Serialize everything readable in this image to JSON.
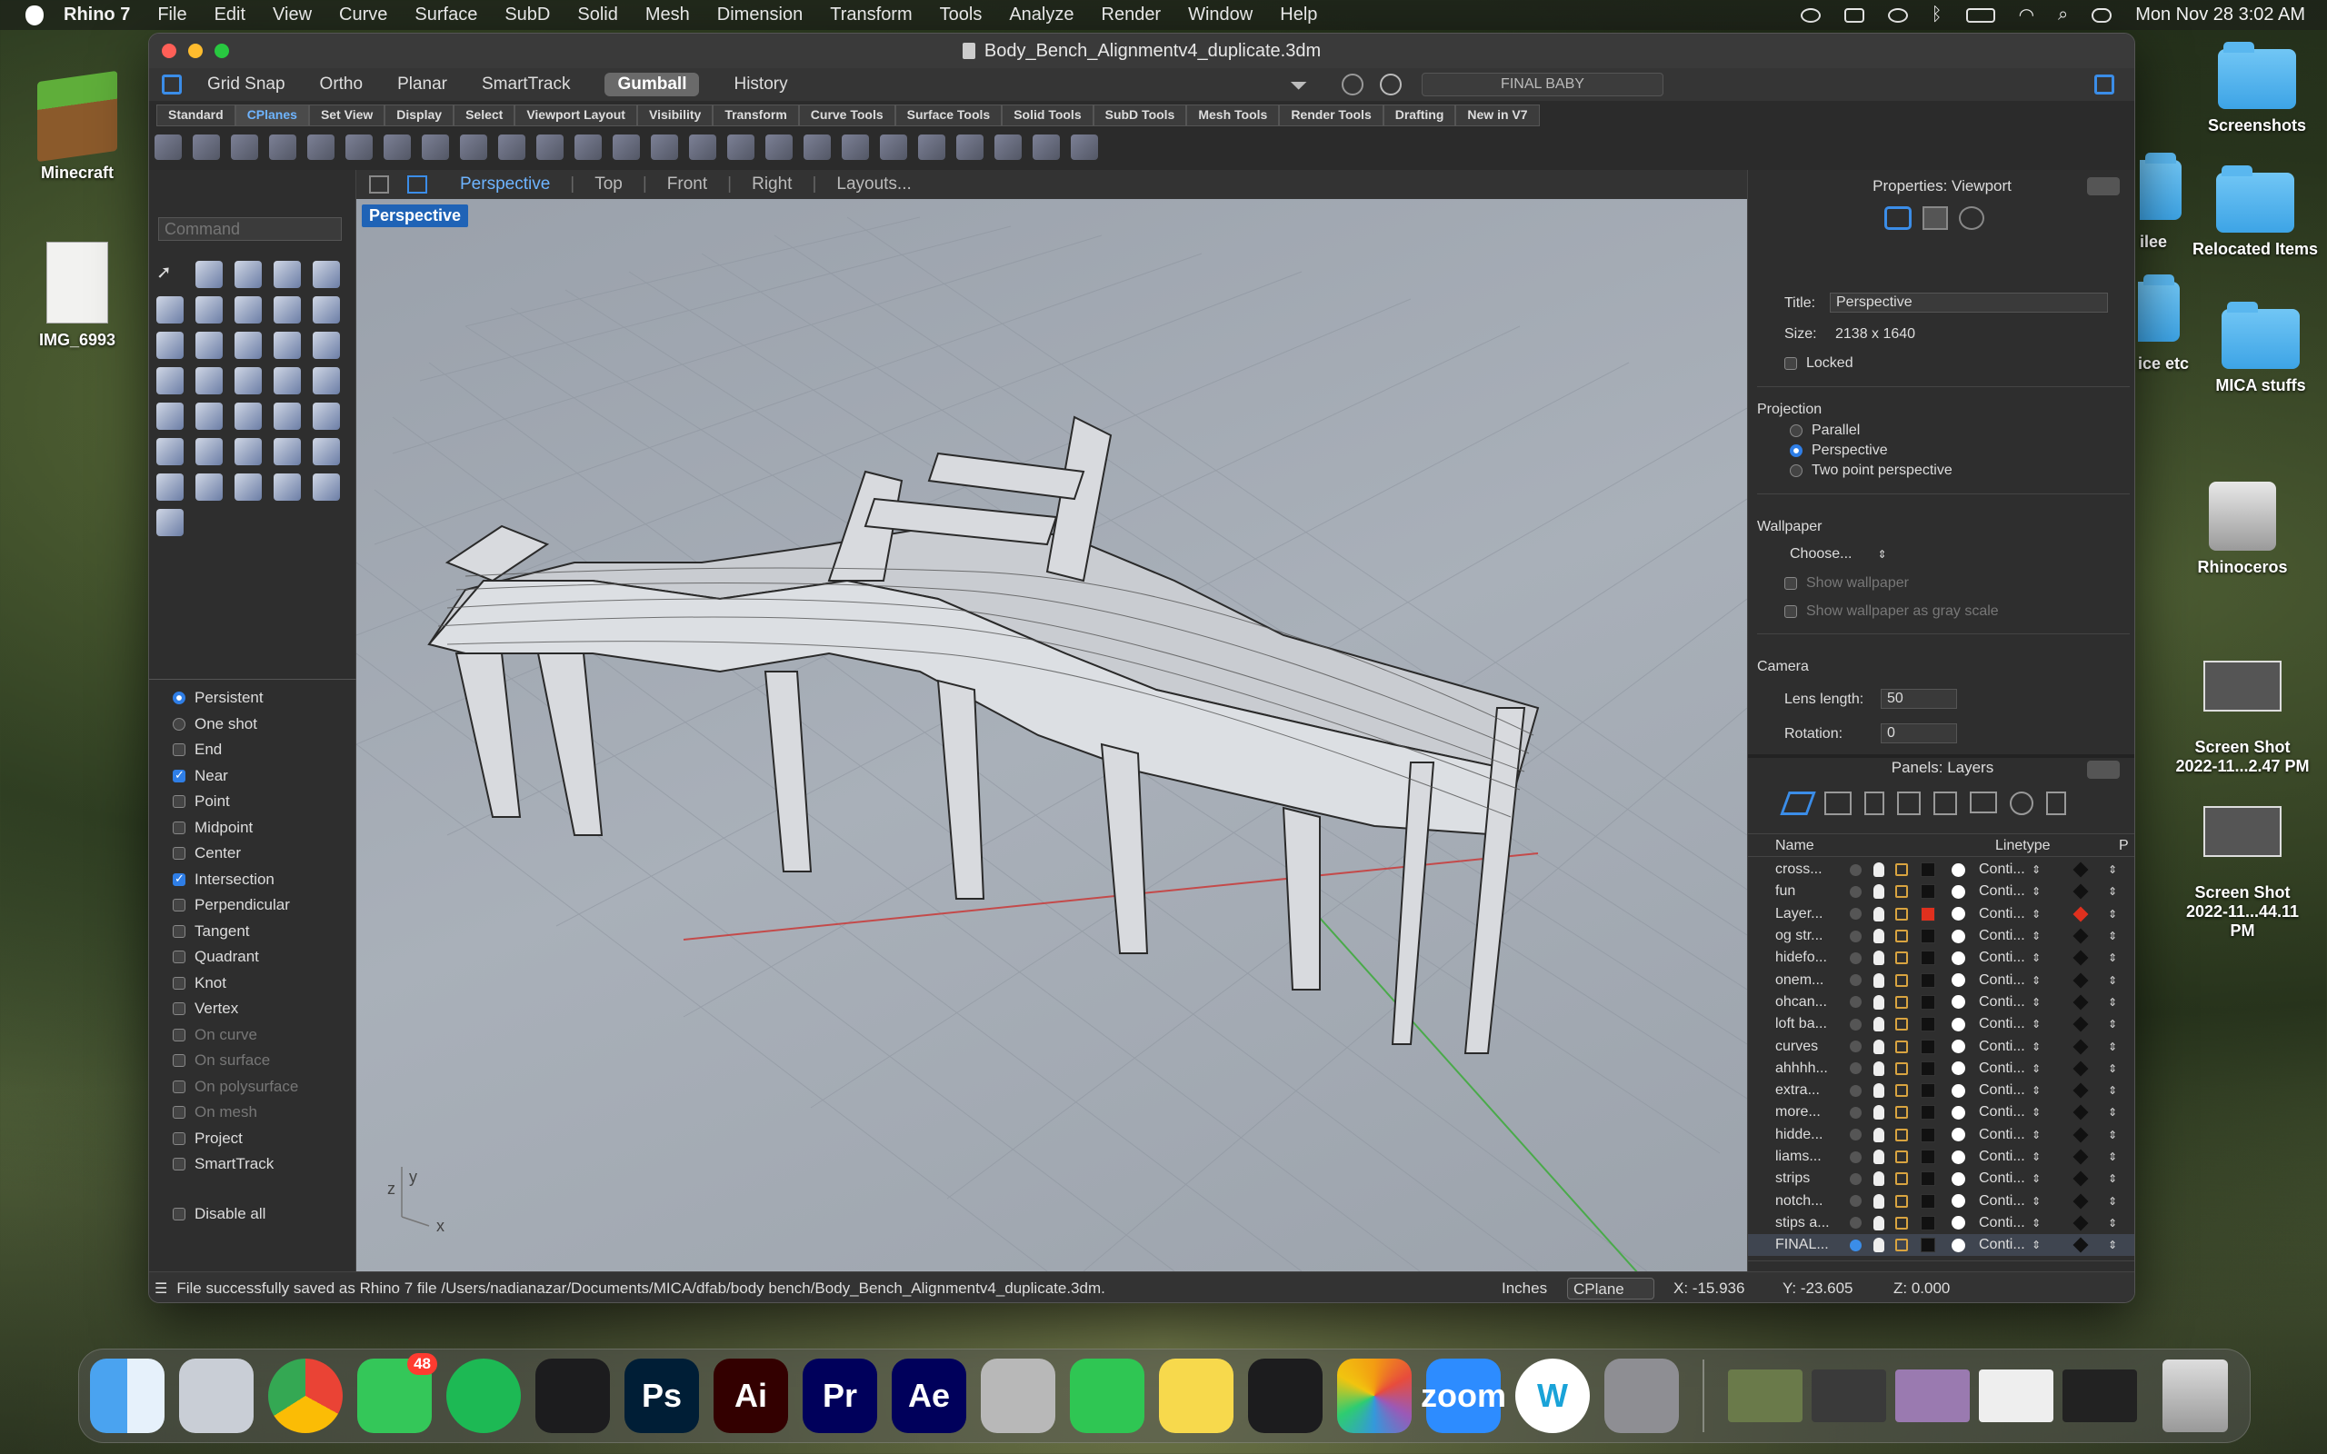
{
  "menubar": {
    "app": "Rhino 7",
    "items": [
      "File",
      "Edit",
      "View",
      "Curve",
      "Surface",
      "SubD",
      "Solid",
      "Mesh",
      "Dimension",
      "Transform",
      "Tools",
      "Analyze",
      "Render",
      "Window",
      "Help"
    ],
    "datetime": "Mon Nov 28  3:02 AM"
  },
  "desktop": {
    "left": [
      {
        "label": "Minecraft"
      },
      {
        "label": "IMG_6993"
      }
    ],
    "right": [
      {
        "label": "Screenshots"
      },
      {
        "label": "Relocated Items"
      },
      {
        "label": "MICA stuffs"
      },
      {
        "label": "Rhinoceros"
      },
      {
        "label": "Screen Shot\n2022-11...2.47 PM"
      },
      {
        "label": "Screen Shot\n2022-11...44.11 PM"
      }
    ],
    "partial": [
      "ilee",
      "ice etc"
    ]
  },
  "window": {
    "title": "Body_Bench_Alignmentv4_duplicate.3dm"
  },
  "toolbar": {
    "items": [
      "Grid Snap",
      "Ortho",
      "Planar",
      "SmartTrack",
      "Gumball",
      "History"
    ],
    "active": "Gumball",
    "layer_field": "FINAL BABY"
  },
  "tabs": [
    "Standard",
    "CPlanes",
    "Set View",
    "Display",
    "Select",
    "Viewport Layout",
    "Visibility",
    "Transform",
    "Curve Tools",
    "Surface Tools",
    "Solid Tools",
    "SubD Tools",
    "Mesh Tools",
    "Render Tools",
    "Drafting",
    "New in V7"
  ],
  "tab_active": "CPlanes",
  "command": {
    "placeholder": "Command"
  },
  "osnap": {
    "modes": [
      {
        "label": "Persistent",
        "type": "radio",
        "on": true
      },
      {
        "label": "One shot",
        "type": "radio",
        "on": false
      }
    ],
    "items": [
      {
        "label": "End",
        "on": false
      },
      {
        "label": "Near",
        "on": true
      },
      {
        "label": "Point",
        "on": false
      },
      {
        "label": "Midpoint",
        "on": false
      },
      {
        "label": "Center",
        "on": false
      },
      {
        "label": "Intersection",
        "on": true
      },
      {
        "label": "Perpendicular",
        "on": false
      },
      {
        "label": "Tangent",
        "on": false
      },
      {
        "label": "Quadrant",
        "on": false
      },
      {
        "label": "Knot",
        "on": false
      },
      {
        "label": "Vertex",
        "on": false
      },
      {
        "label": "On curve",
        "on": false,
        "dim": true
      },
      {
        "label": "On surface",
        "on": false,
        "dim": true
      },
      {
        "label": "On polysurface",
        "on": false,
        "dim": true
      },
      {
        "label": "On mesh",
        "on": false,
        "dim": true
      },
      {
        "label": "Project",
        "on": false
      },
      {
        "label": "SmartTrack",
        "on": false
      }
    ],
    "disable_all": "Disable all"
  },
  "viewport_tabs": [
    "Perspective",
    "Top",
    "Front",
    "Right",
    "Layouts..."
  ],
  "viewport": {
    "label": "Perspective",
    "axis_z": "z",
    "axis_y": "y",
    "axis_x": "x"
  },
  "properties": {
    "header": "Properties: Viewport",
    "title_label": "Title:",
    "title_value": "Perspective",
    "size_label": "Size:",
    "size_value": "2138 x 1640",
    "locked": "Locked",
    "projection_label": "Projection",
    "projections": [
      {
        "label": "Parallel",
        "on": false
      },
      {
        "label": "Perspective",
        "on": true
      },
      {
        "label": "Two point perspective",
        "on": false
      }
    ],
    "wallpaper_label": "Wallpaper",
    "wallpaper_choose": "Choose...",
    "show_wallpaper": "Show wallpaper",
    "gray_scale": "Show wallpaper as gray scale",
    "camera_label": "Camera",
    "lens_label": "Lens length:",
    "lens_value": "50",
    "rotation_label": "Rotation:",
    "rotation_value": "0"
  },
  "layers": {
    "header": "Panels: Layers",
    "col_name": "Name",
    "col_linetype": "Linetype",
    "col_p": "P",
    "rows": [
      {
        "name": "cross...",
        "color": "#111111",
        "lt": "Conti..."
      },
      {
        "name": "fun",
        "color": "#111111",
        "lt": "Conti..."
      },
      {
        "name": "Layer...",
        "color": "#e0301e",
        "lt": "Conti...",
        "red": true
      },
      {
        "name": "og str...",
        "color": "#111111",
        "lt": "Conti..."
      },
      {
        "name": "hidefo...",
        "color": "#111111",
        "lt": "Conti..."
      },
      {
        "name": "onem...",
        "color": "#111111",
        "lt": "Conti..."
      },
      {
        "name": "ohcan...",
        "color": "#111111",
        "lt": "Conti..."
      },
      {
        "name": "loft ba...",
        "color": "#111111",
        "lt": "Conti..."
      },
      {
        "name": "curves",
        "color": "#111111",
        "lt": "Conti..."
      },
      {
        "name": "ahhhh...",
        "color": "#111111",
        "lt": "Conti..."
      },
      {
        "name": "extra...",
        "color": "#111111",
        "lt": "Conti..."
      },
      {
        "name": "more...",
        "color": "#111111",
        "lt": "Conti..."
      },
      {
        "name": "hidde...",
        "color": "#111111",
        "lt": "Conti..."
      },
      {
        "name": "liams...",
        "color": "#111111",
        "lt": "Conti..."
      },
      {
        "name": "strips",
        "color": "#111111",
        "lt": "Conti..."
      },
      {
        "name": "notch...",
        "color": "#111111",
        "lt": "Conti..."
      },
      {
        "name": "stips a...",
        "color": "#111111",
        "lt": "Conti..."
      },
      {
        "name": "FINAL...",
        "color": "#111111",
        "lt": "Conti...",
        "current": true
      }
    ]
  },
  "status": {
    "message": "File successfully saved as Rhino 7 file /Users/nadianazar/Documents/MICA/dfab/body bench/Body_Bench_Alignmentv4_duplicate.3dm.",
    "units": "Inches",
    "cplane": "CPlane",
    "x": "X: -15.936",
    "y": "Y: -23.605",
    "z": "Z: 0.000"
  },
  "dock": {
    "messages_badge": "48",
    "apps": [
      {
        "name": "finder",
        "label": "",
        "bg": "#4aa3f0"
      },
      {
        "name": "launchpad",
        "label": "",
        "bg": "#c9ced6"
      },
      {
        "name": "chrome",
        "label": "",
        "bg": "#e8e8e8"
      },
      {
        "name": "messages",
        "label": "",
        "bg": "#34c759"
      },
      {
        "name": "spotify",
        "label": "",
        "bg": "#1db954"
      },
      {
        "name": "voice",
        "label": "",
        "bg": "#1c1c1e"
      },
      {
        "name": "photoshop",
        "label": "Ps",
        "bg": "#001e36"
      },
      {
        "name": "illustrator",
        "label": "Ai",
        "bg": "#330000"
      },
      {
        "name": "premiere",
        "label": "Pr",
        "bg": "#00005b"
      },
      {
        "name": "aftereffects",
        "label": "Ae",
        "bg": "#00005b"
      },
      {
        "name": "rhino",
        "label": "",
        "bg": "#b8b8b8"
      },
      {
        "name": "facetime",
        "label": "",
        "bg": "#2fc653"
      },
      {
        "name": "notes",
        "label": "",
        "bg": "#f7d94c"
      },
      {
        "name": "activity",
        "label": "",
        "bg": "#1c1c1e"
      },
      {
        "name": "photos",
        "label": "",
        "bg": "#f4f4f4"
      },
      {
        "name": "zoom",
        "label": "zoom",
        "bg": "#2d8cff"
      },
      {
        "name": "webex",
        "label": "W",
        "bg": "#ffffff"
      },
      {
        "name": "settings",
        "label": "",
        "bg": "#8e8e93"
      }
    ]
  }
}
